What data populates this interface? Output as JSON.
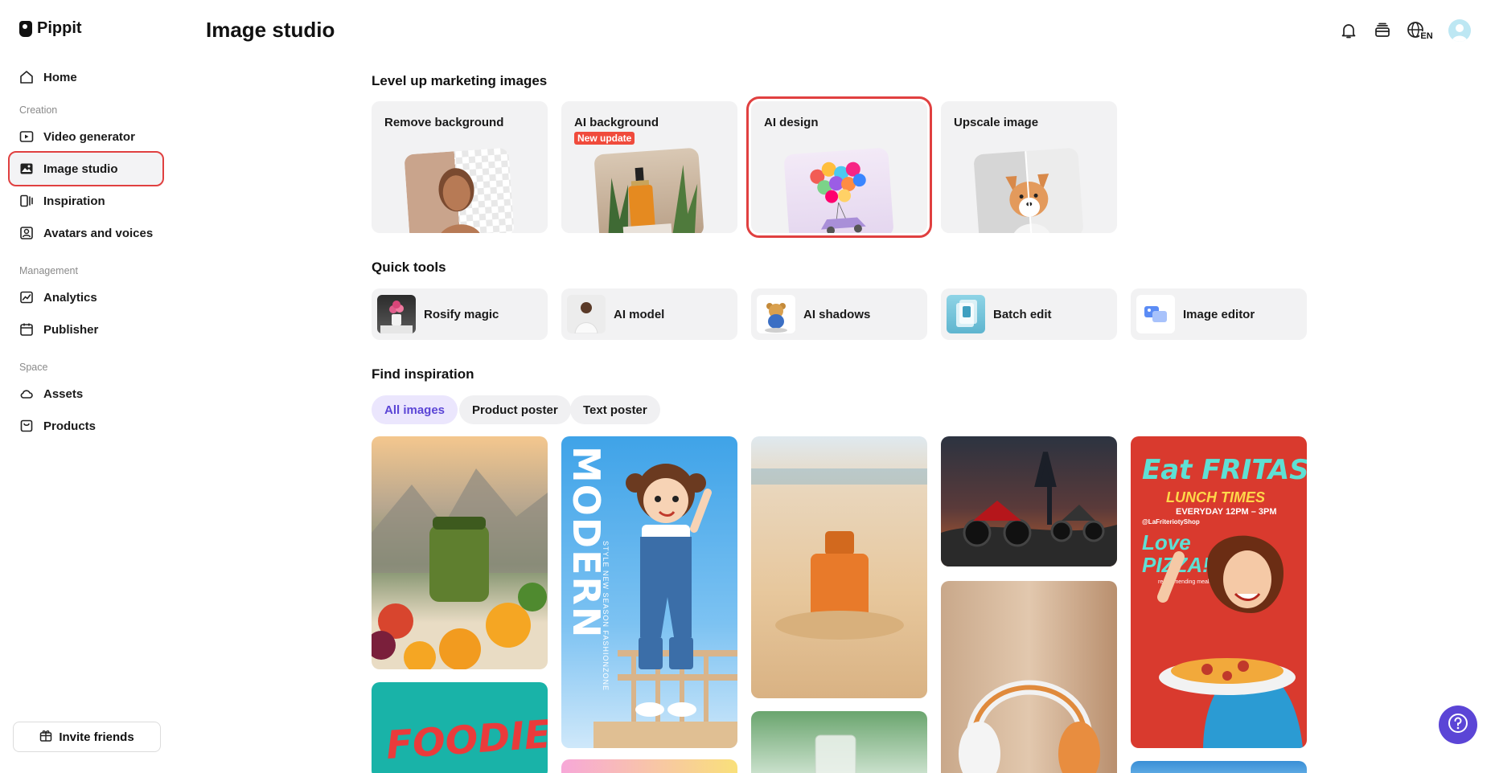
{
  "app": {
    "name": "Pippit"
  },
  "sidebar": {
    "home": "Home",
    "sections": {
      "creation": "Creation",
      "management": "Management",
      "space": "Space"
    },
    "items": {
      "video_generator": "Video generator",
      "image_studio": "Image studio",
      "inspiration": "Inspiration",
      "avatars_voices": "Avatars and voices",
      "analytics": "Analytics",
      "publisher": "Publisher",
      "assets": "Assets",
      "products": "Products"
    },
    "invite_label": "Invite friends"
  },
  "header": {
    "title": "Image studio",
    "language_code": "EN",
    "icons": [
      "bell-icon",
      "stack-icon",
      "globe-icon",
      "avatar"
    ]
  },
  "level_up": {
    "title": "Level up marketing images",
    "cards": [
      {
        "label": "Remove background"
      },
      {
        "label": "AI background",
        "badge": "New update"
      },
      {
        "label": "AI design"
      },
      {
        "label": "Upscale image"
      }
    ]
  },
  "quick_tools": {
    "title": "Quick tools",
    "items": [
      "Rosify magic",
      "AI model",
      "AI shadows",
      "Batch edit",
      "Image editor"
    ]
  },
  "find_inspiration": {
    "title": "Find inspiration",
    "filters": [
      "All images",
      "Product poster",
      "Text poster"
    ],
    "selected_filter": "All images",
    "gallery_text": {
      "modern": "MODERN",
      "modern_sub": "STYLE NEW SEASON FASHIONZONE",
      "eat_fritas": "Eat FRITAS!",
      "lunch_times": "LUNCH TIMES",
      "everyday": "EVERYDAY 12PM – 3PM",
      "shop_handle": "@LaFriteriotyShop",
      "love_pizza": "Love PIZZA!",
      "recommending": "recommending meals",
      "foodie": "FOODIE"
    }
  },
  "colors": {
    "accent": "#5b45d6",
    "highlight_outline": "#e04040",
    "badge": "#f04b3c",
    "card_bg": "#f2f2f3"
  }
}
